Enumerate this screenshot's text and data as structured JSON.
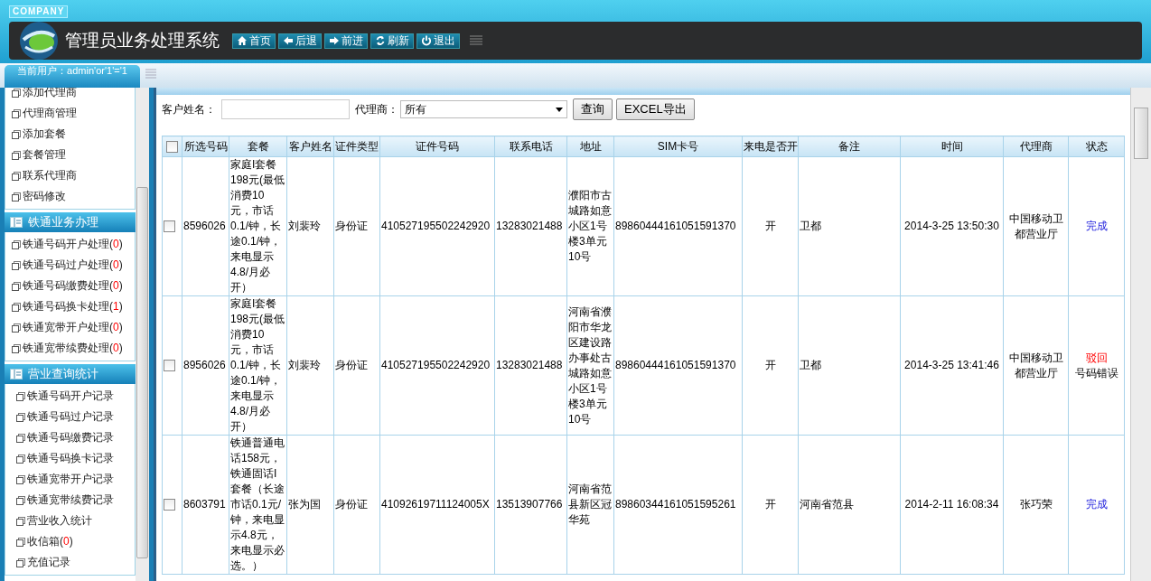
{
  "header": {
    "company": "COMPANY",
    "title": "管理员业务处理系统",
    "buttons": [
      {
        "kind": "home",
        "label": "首页"
      },
      {
        "kind": "back",
        "label": "后退"
      },
      {
        "kind": "forward",
        "label": "前进"
      },
      {
        "kind": "refresh",
        "label": "刷新"
      },
      {
        "kind": "logout",
        "label": "退出"
      }
    ]
  },
  "user_label": "当前用户：admin'or'1'='1",
  "sidebar": {
    "sections": [
      {
        "items": [
          {
            "label": "添加代理商"
          },
          {
            "label": "代理商管理"
          },
          {
            "label": "添加套餐"
          },
          {
            "label": "套餐管理"
          },
          {
            "label": "联系代理商"
          },
          {
            "label": "密码修改"
          }
        ]
      },
      {
        "title": "铁通业务办理",
        "items": [
          {
            "label": "铁通号码开户处理",
            "count": "(0)"
          },
          {
            "label": "铁通号码过户处理",
            "count": "(0)"
          },
          {
            "label": "铁通号码缴费处理",
            "count": "(0)"
          },
          {
            "label": "铁通号码换卡处理",
            "count": "(1)"
          },
          {
            "label": "铁通宽带开户处理",
            "count": "(0)"
          },
          {
            "label": "铁通宽带续费处理",
            "count": "(0)"
          }
        ]
      },
      {
        "title": "营业查询统计",
        "items": [
          {
            "label": "铁通号码开户记录"
          },
          {
            "label": "铁通号码过户记录"
          },
          {
            "label": "铁通号码缴费记录"
          },
          {
            "label": "铁通号码换卡记录"
          },
          {
            "label": "铁通宽带开户记录"
          },
          {
            "label": "铁通宽带续费记录"
          },
          {
            "label": "营业收入统计"
          },
          {
            "label": "收信箱",
            "count": "(0)"
          },
          {
            "label": "充值记录"
          }
        ]
      }
    ]
  },
  "search": {
    "name_label": "客户姓名：",
    "agent_label": "代理商：",
    "agent_value": "所有",
    "query_button": "查询",
    "export_button": "EXCEL导出"
  },
  "table": {
    "all_checked": false,
    "columns": [
      "所选号码",
      "套餐",
      "客户姓名",
      "证件类型",
      "证件号码",
      "联系电话",
      "地址",
      "SIM卡号",
      "来电是否开",
      "备注",
      "时间",
      "代理商",
      "状态"
    ],
    "rows": [
      {
        "checked": false,
        "cells": [
          "8596026",
          "家庭I套餐198元(最低消费10元，市话0.1/钟，长途0.1/钟，来电显示4.8/月必开）",
          "刘裴玲",
          "身份证",
          "410527195502242920",
          "13283021488",
          "濮阳市古城路如意小区1号楼3单元10号",
          "89860444161051591370",
          "开",
          "卫都",
          "2014-3-25 13:50:30",
          "中国移动卫都营业厅"
        ],
        "status": {
          "kind": "done",
          "label": "完成"
        }
      },
      {
        "checked": false,
        "cells": [
          "8956026",
          "家庭I套餐198元(最低消费10元，市话0.1/钟，长途0.1/钟，来电显示4.8/月必开）",
          "刘裴玲",
          "身份证",
          "410527195502242920",
          "13283021488",
          "河南省濮阳市华龙区建设路办事处古城路如意小区1号楼3单元10号",
          "89860444161051591370",
          "开",
          "卫都",
          "2014-3-25 13:41:46",
          "中国移动卫都营业厅"
        ],
        "status": {
          "kind": "rejected",
          "label": "驳回",
          "note": "号码错误"
        }
      },
      {
        "checked": false,
        "cells": [
          "8603791",
          "铁通普通电话158元，铁通固话I套餐（长途市话0.1元/钟，来电显示4.8元，来电显示必选。）",
          "张为国",
          "身份证",
          "4109261971112400​5X",
          "13513907766",
          "河南省范县新区冠华苑",
          "89860344161051595261",
          "开",
          "河南省范县",
          "2014-2-11 16:08:34",
          "张巧荣"
        ],
        "status": {
          "kind": "done",
          "label": "完成"
        }
      }
    ]
  }
}
